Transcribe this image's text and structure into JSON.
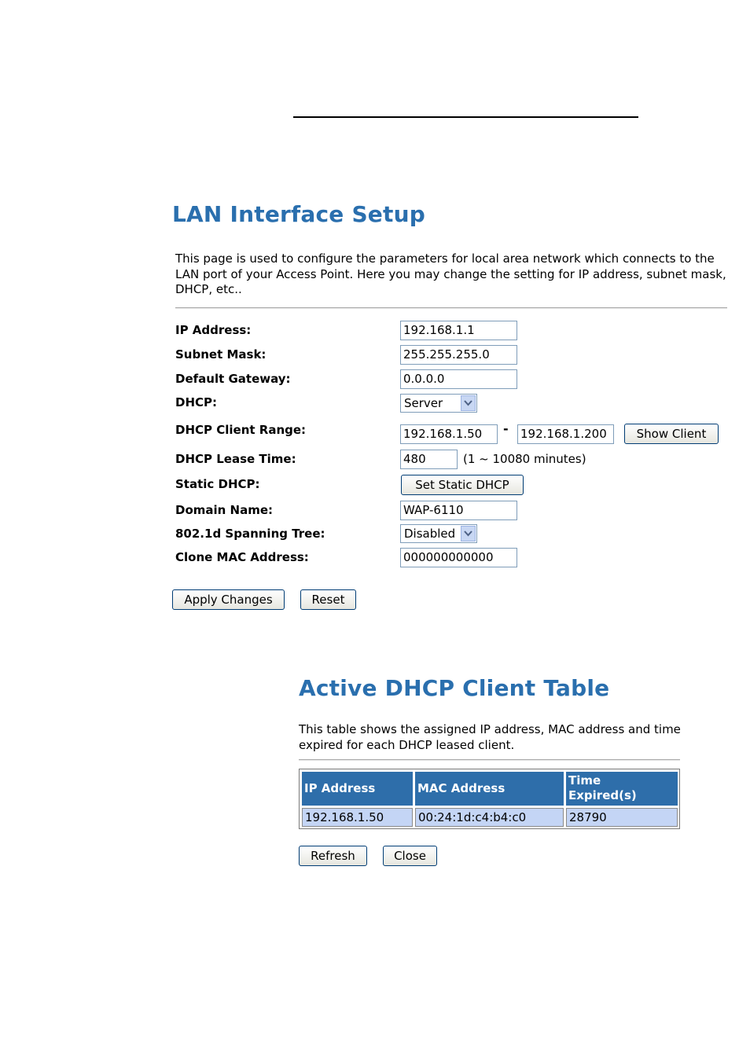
{
  "lan": {
    "title": "LAN Interface Setup",
    "description": "This page is used to configure the parameters for local area network which connects to the LAN port of your Access Point. Here you may change the setting for IP address, subnet mask, DHCP, etc..",
    "fields": {
      "ip_label": "IP Address:",
      "ip_value": "192.168.1.1",
      "mask_label": "Subnet Mask:",
      "mask_value": "255.255.255.0",
      "gw_label": "Default Gateway:",
      "gw_value": "0.0.0.0",
      "dhcp_label": "DHCP:",
      "dhcp_value": "Server",
      "range_label": "DHCP Client Range:",
      "range_start": "192.168.1.50",
      "range_dash": "-",
      "range_end": "192.168.1.200",
      "show_client_label": "Show Client",
      "lease_label": "DHCP Lease Time:",
      "lease_value": "480",
      "lease_hint": "(1 ~ 10080 minutes)",
      "static_label": "Static DHCP:",
      "static_button": "Set Static DHCP",
      "domain_label": "Domain Name:",
      "domain_value": "WAP-6110",
      "stp_label": "802.1d Spanning Tree:",
      "stp_value": "Disabled",
      "clone_label": "Clone MAC Address:",
      "clone_value": "000000000000"
    },
    "apply_label": "Apply Changes",
    "reset_label": "Reset"
  },
  "dhcp_table": {
    "title": "Active DHCP Client Table",
    "description": "This table shows the assigned IP address, MAC address and time expired for each DHCP leased client.",
    "headers": {
      "ip": "IP Address",
      "mac": "MAC Address",
      "time_line1": "Time",
      "time_line2": "Expired(s)"
    },
    "rows": [
      {
        "ip": "192.168.1.50",
        "mac": "00:24:1d:c4:b4:c0",
        "time": "28790"
      }
    ],
    "refresh_label": "Refresh",
    "close_label": "Close"
  },
  "colors": {
    "heading": "#2a6fae",
    "table_header": "#2e6eaa",
    "table_cell": "#c4d5f5"
  },
  "icons": {
    "select_arrow": "chevron-down-icon"
  }
}
